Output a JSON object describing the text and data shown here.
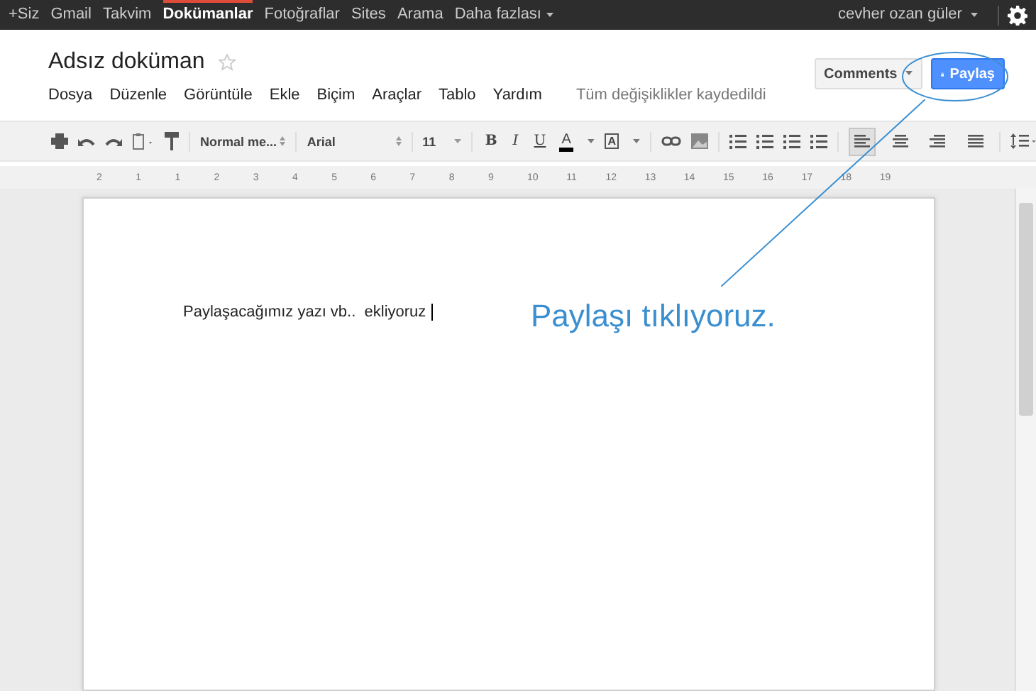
{
  "top_nav": [
    {
      "label": "+Siz",
      "selected": false
    },
    {
      "label": "Gmail",
      "selected": false
    },
    {
      "label": "Takvim",
      "selected": false
    },
    {
      "label": "Dokümanlar",
      "selected": true
    },
    {
      "label": "Fotoğraflar",
      "selected": false
    },
    {
      "label": "Sites",
      "selected": false
    },
    {
      "label": "Arama",
      "selected": false
    },
    {
      "label": "Daha fazlası",
      "selected": false
    }
  ],
  "user": "cevher ozan güler",
  "document": {
    "title": "Adsız doküman",
    "starred": false
  },
  "menu": [
    "Dosya",
    "Düzenle",
    "Görüntüle",
    "Ekle",
    "Biçim",
    "Araçlar",
    "Tablo",
    "Yardım"
  ],
  "save_status": "Tüm değişiklikler kaydedildi",
  "comments_button": "Comments",
  "share_button": "Paylaş",
  "toolbar": {
    "style": "Normal me...",
    "font": "Arial",
    "size": "11",
    "bold": "B",
    "italic": "I",
    "underline": "U",
    "text_color": "A",
    "highlight": "A"
  },
  "alignment": [
    {
      "selected": true
    },
    {
      "selected": false
    },
    {
      "selected": false
    },
    {
      "selected": false
    }
  ],
  "ruler": [
    "2",
    "1",
    "1",
    "2",
    "3",
    "4",
    "5",
    "6",
    "7",
    "8",
    "9",
    "10",
    "11",
    "12",
    "13",
    "14",
    "15",
    "16",
    "17",
    "18",
    "19"
  ],
  "body_text": "Paylaşacağımız yazı vb..  ekliyoruz",
  "annotation": "Paylaşı tıklıyoruz."
}
